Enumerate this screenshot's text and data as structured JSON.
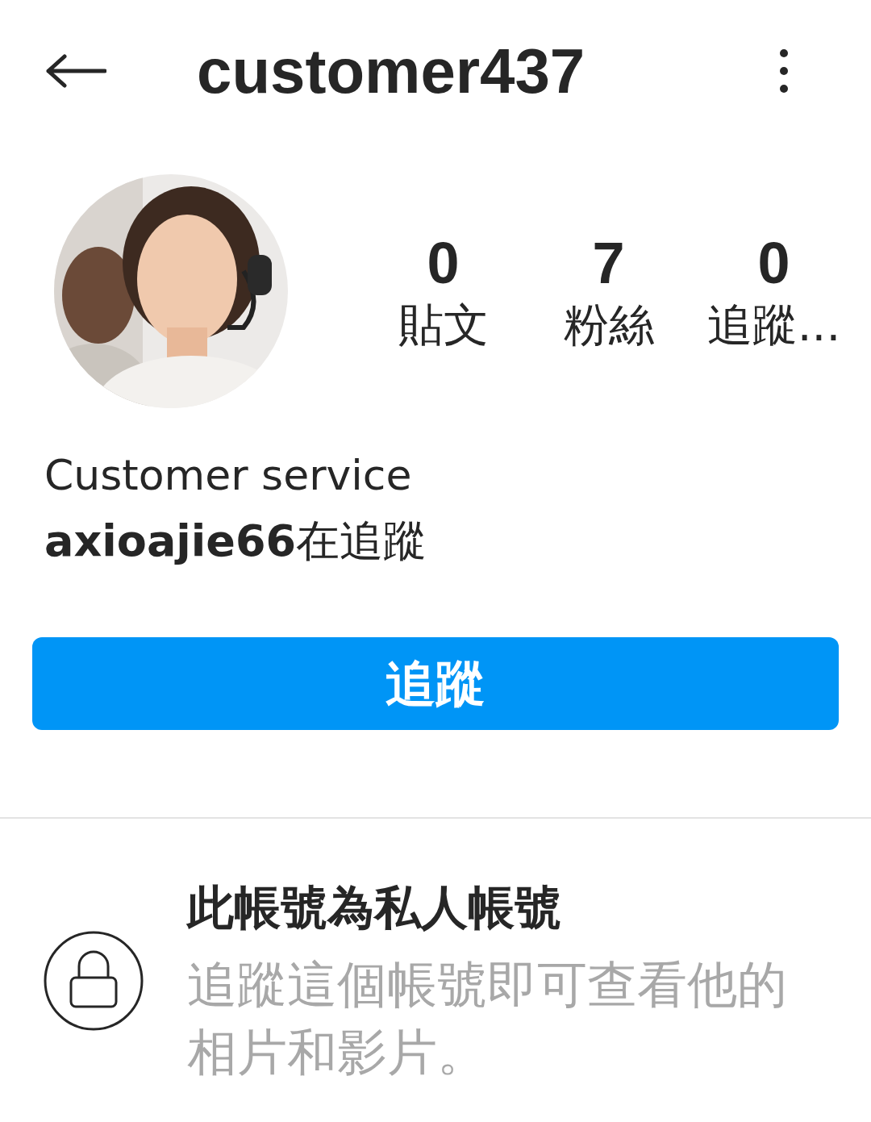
{
  "header": {
    "title": "customer437"
  },
  "profile": {
    "stats": [
      {
        "value": "0",
        "label": "貼文"
      },
      {
        "value": "7",
        "label": "粉絲"
      },
      {
        "value": "0",
        "label": "追蹤..."
      }
    ],
    "name": "Customer service",
    "followed_by": "**axioajie66**在追蹤",
    "follow_button": "追蹤"
  },
  "private_notice": {
    "title": "此帳號為私人帳號",
    "message": "追蹤這個帳號即可查看他的相片和影片。"
  }
}
